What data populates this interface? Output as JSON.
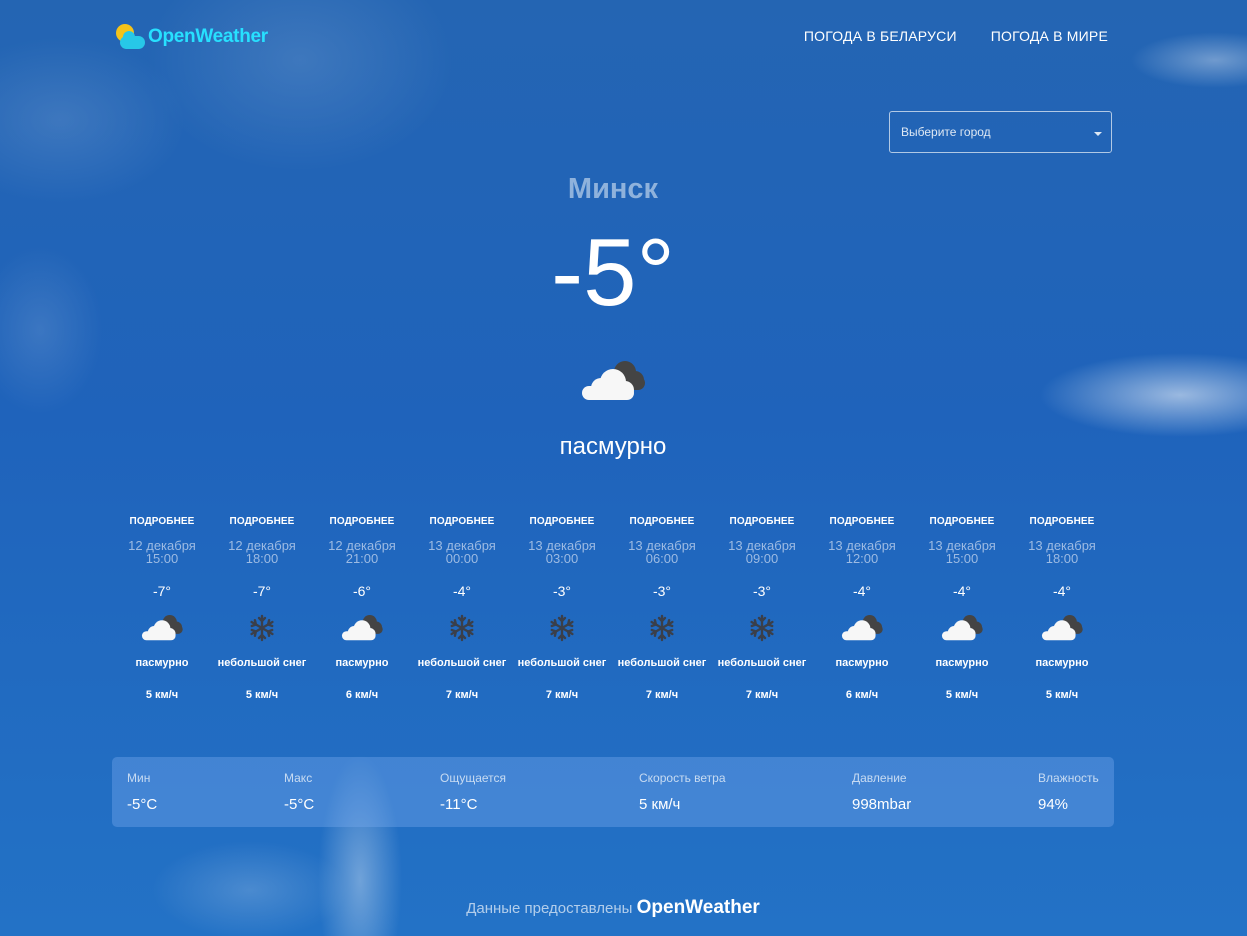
{
  "header": {
    "logo_text": "OpenWeather",
    "nav": [
      "ПОГОДА В БЕЛАРУСИ",
      "ПОГОДА В МИРЕ"
    ]
  },
  "city_select": {
    "placeholder": "Выберите город"
  },
  "current": {
    "city": "Минск",
    "temp": "-5°",
    "icon": "overcast",
    "description": "пасмурно"
  },
  "forecast": [
    {
      "more": "ПОДРОБНЕЕ",
      "date": "12 декабря",
      "time": "15:00",
      "temp": "-7°",
      "icon": "overcast",
      "desc": "пасмурно",
      "wind": "5 км/ч"
    },
    {
      "more": "ПОДРОБНЕЕ",
      "date": "12 декабря",
      "time": "18:00",
      "temp": "-7°",
      "icon": "snow",
      "desc": "небольшой снег",
      "wind": "5 км/ч"
    },
    {
      "more": "ПОДРОБНЕЕ",
      "date": "12 декабря",
      "time": "21:00",
      "temp": "-6°",
      "icon": "overcast",
      "desc": "пасмурно",
      "wind": "6 км/ч"
    },
    {
      "more": "ПОДРОБНЕЕ",
      "date": "13 декабря",
      "time": "00:00",
      "temp": "-4°",
      "icon": "snow",
      "desc": "небольшой снег",
      "wind": "7 км/ч"
    },
    {
      "more": "ПОДРОБНЕЕ",
      "date": "13 декабря",
      "time": "03:00",
      "temp": "-3°",
      "icon": "snow",
      "desc": "небольшой снег",
      "wind": "7 км/ч"
    },
    {
      "more": "ПОДРОБНЕЕ",
      "date": "13 декабря",
      "time": "06:00",
      "temp": "-3°",
      "icon": "snow",
      "desc": "небольшой снег",
      "wind": "7 км/ч"
    },
    {
      "more": "ПОДРОБНЕЕ",
      "date": "13 декабря",
      "time": "09:00",
      "temp": "-3°",
      "icon": "snow",
      "desc": "небольшой снег",
      "wind": "7 км/ч"
    },
    {
      "more": "ПОДРОБНЕЕ",
      "date": "13 декабря",
      "time": "12:00",
      "temp": "-4°",
      "icon": "overcast",
      "desc": "пасмурно",
      "wind": "6 км/ч"
    },
    {
      "more": "ПОДРОБНЕЕ",
      "date": "13 декабря",
      "time": "15:00",
      "temp": "-4°",
      "icon": "overcast",
      "desc": "пасмурно",
      "wind": "5 км/ч"
    },
    {
      "more": "ПОДРОБНЕЕ",
      "date": "13 декабря",
      "time": "18:00",
      "temp": "-4°",
      "icon": "overcast",
      "desc": "пасмурно",
      "wind": "5 км/ч"
    }
  ],
  "stats": [
    {
      "label": "Мин",
      "value": "-5°C"
    },
    {
      "label": "Макс",
      "value": "-5°C"
    },
    {
      "label": "Ощущается",
      "value": "-11°C"
    },
    {
      "label": "Скорость ветра",
      "value": "5 км/ч"
    },
    {
      "label": "Давление",
      "value": "998mbar"
    },
    {
      "label": "Влажность",
      "value": "94%"
    }
  ],
  "footer": {
    "text": "Данные предоставлены",
    "brand": "OpenWeather"
  }
}
